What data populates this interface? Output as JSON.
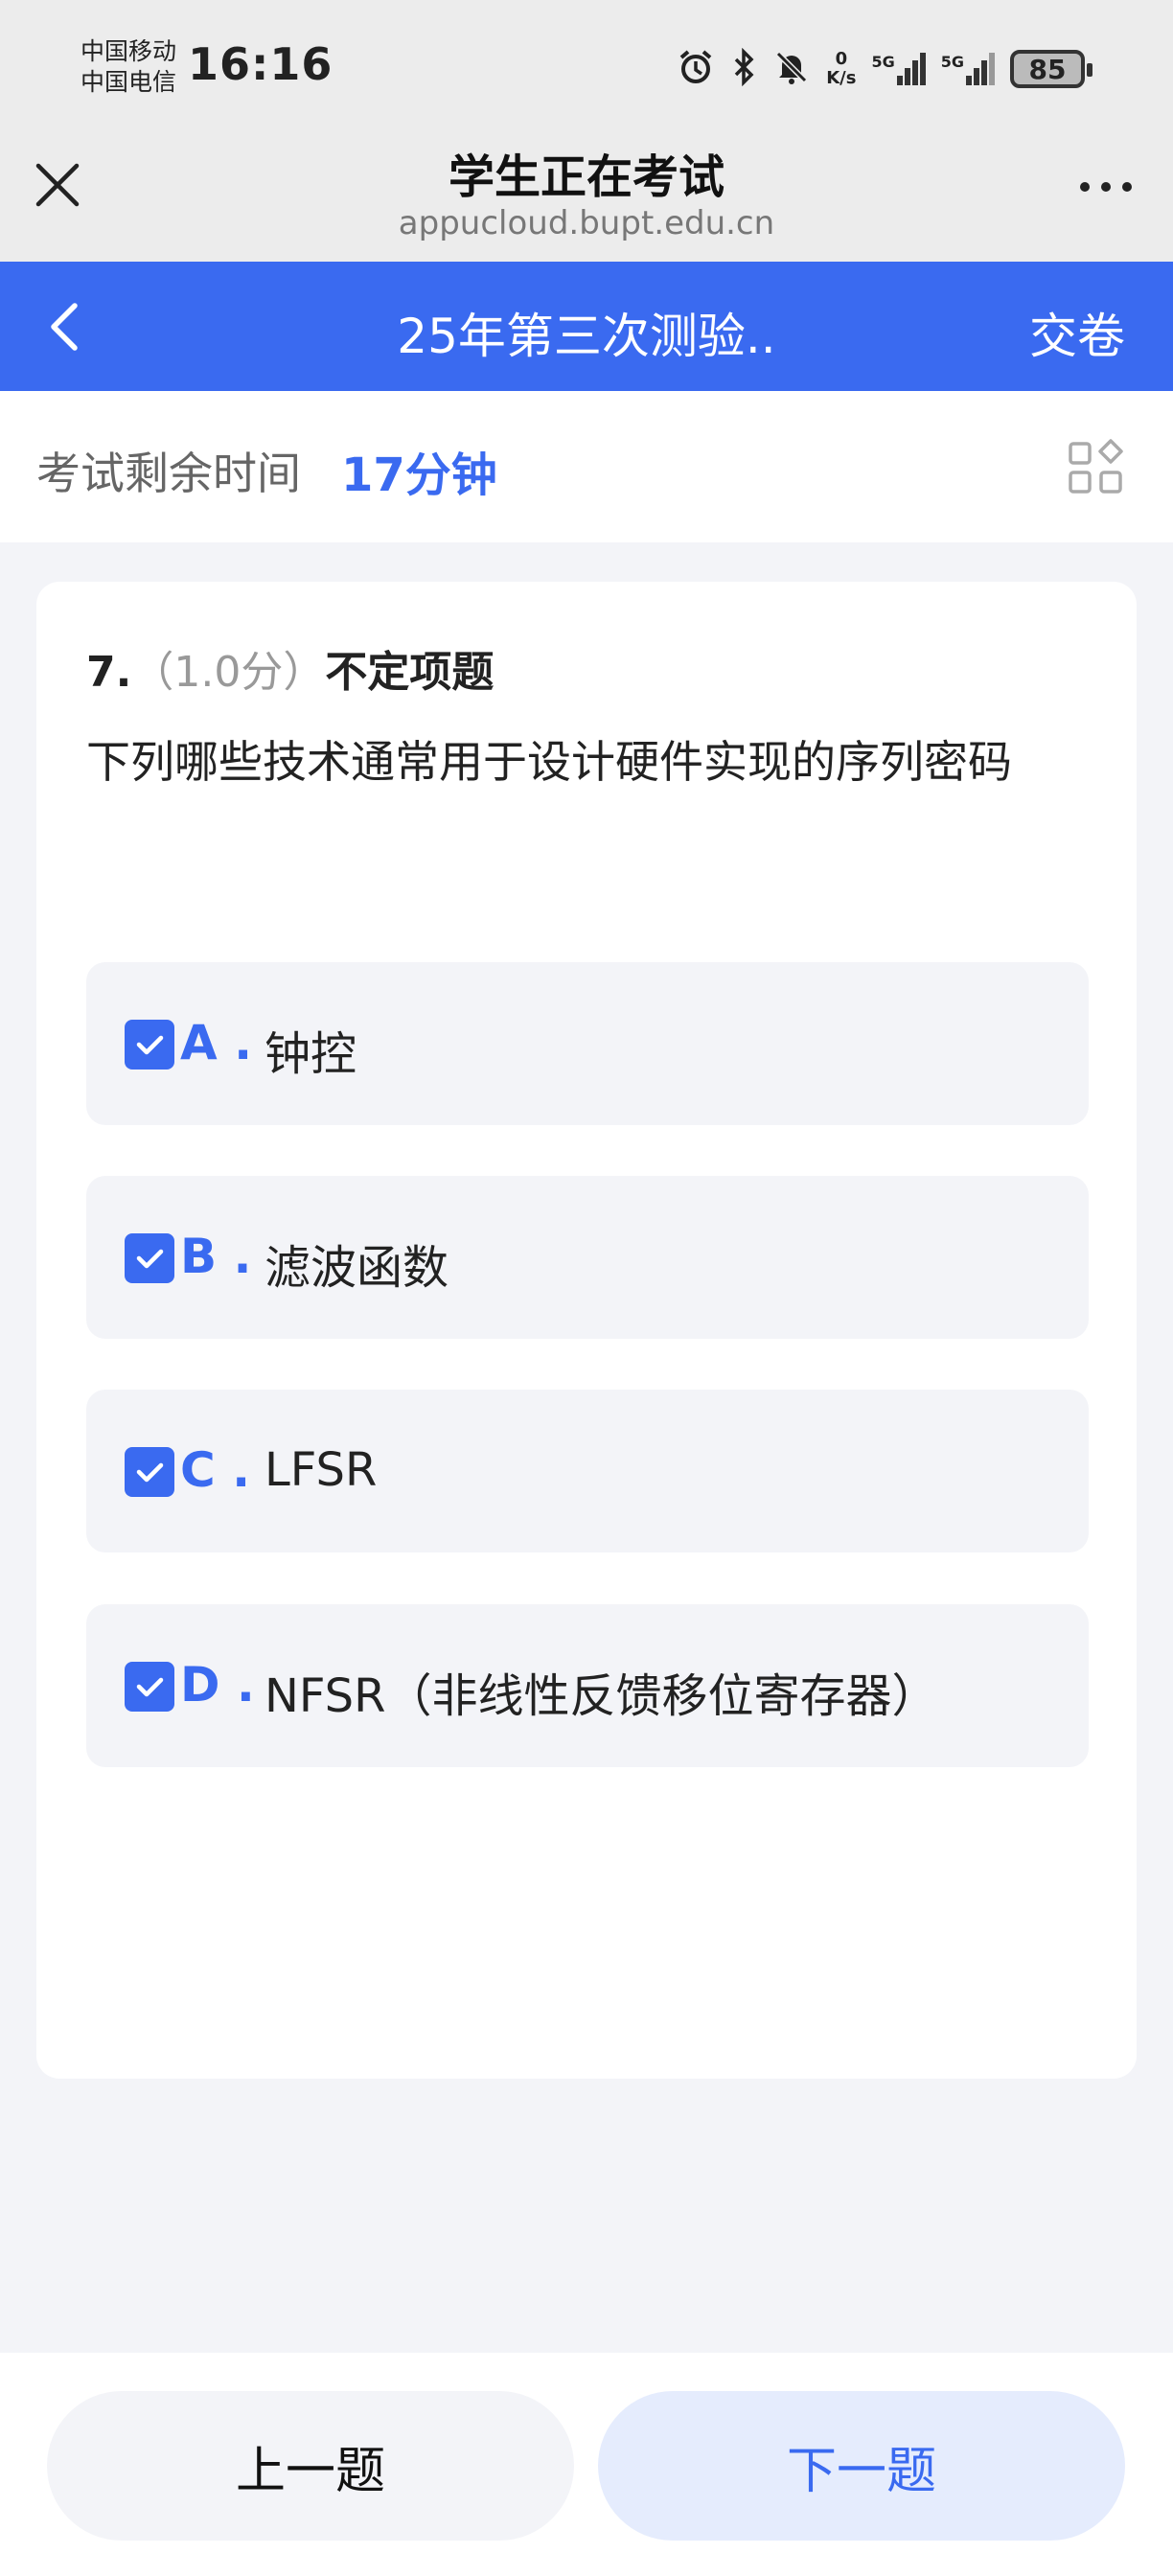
{
  "status_bar": {
    "carrier_1": "中国移动",
    "carrier_2": "中国电信",
    "time": "16:16",
    "net_speed_value": "0",
    "net_speed_unit": "K/s",
    "sim1_network": "5G",
    "sim2_network": "5G",
    "battery": "85"
  },
  "browser_header": {
    "title": "学生正在考试",
    "url": "appucloud.bupt.edu.cn"
  },
  "nav": {
    "title": "25年第三次测验..",
    "submit_label": "交卷"
  },
  "timer": {
    "label": "考试剩余时间",
    "value": "17分钟"
  },
  "question": {
    "number": "7.",
    "score": "（1.0分）",
    "type": "不定项题",
    "text": "下列哪些技术通常用于设计硬件实现的序列密码",
    "options": [
      {
        "letter": "A .",
        "text": "钟控",
        "checked": true
      },
      {
        "letter": "B .",
        "text": "滤波函数",
        "checked": true
      },
      {
        "letter": "C .",
        "text": "LFSR",
        "checked": true
      },
      {
        "letter": "D .",
        "text": "NFSR（非线性反馈移位寄存器）",
        "checked": true
      }
    ]
  },
  "footer": {
    "prev_label": "上一题",
    "next_label": "下一题"
  },
  "colors": {
    "accent": "#3a6af0",
    "background": "#f3f4f8",
    "next_button_bg": "#e5ecfd"
  }
}
